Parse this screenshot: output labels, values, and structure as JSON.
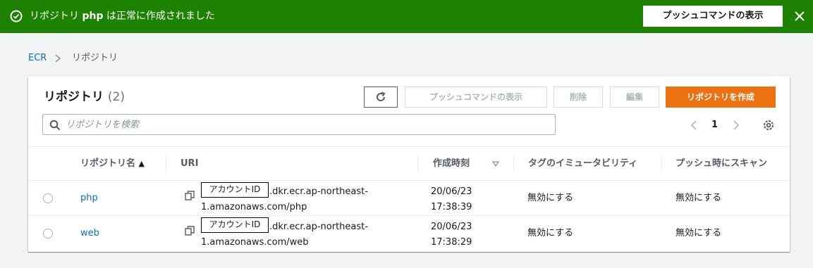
{
  "flash": {
    "message_prefix": "リポジトリ ",
    "repo_name": "php",
    "message_suffix": " は正常に作成されました",
    "push_commands_label": "プッシュコマンドの表示",
    "color": "#1d8102"
  },
  "breadcrumb": {
    "root": "ECR",
    "current": "リポジトリ"
  },
  "panel": {
    "title": "リポジトリ",
    "count": "(2)",
    "push_commands_label": "プッシュコマンドの表示",
    "delete_label": "削除",
    "edit_label": "編集",
    "create_label": "リポジトリを作成",
    "accent_color": "#ec7211",
    "refresh_icon": "refresh-icon"
  },
  "search": {
    "placeholder": "リポジトリを検索",
    "value": ""
  },
  "pagination": {
    "current_page": "1"
  },
  "table": {
    "columns": {
      "name": "リポジトリ名",
      "name_sort": "▲",
      "uri": "URI",
      "created": "作成時刻",
      "tag_immutability": "タグのイミュータビリティ",
      "scan_on_push": "プッシュ時にスキャン"
    },
    "rows": [
      {
        "name": "php",
        "account_id_label": "アカウントID",
        "uri_line1": ".dkr.ecr.ap-northeast-",
        "uri_line2": "1.amazonaws.com/php",
        "created_date": "20/06/23",
        "created_time": "17:38:39",
        "tag_immutability": "無効にする",
        "scan_on_push": "無効にする"
      },
      {
        "name": "web",
        "account_id_label": "アカウントID",
        "uri_line1": ".dkr.ecr.ap-northeast-",
        "uri_line2": "1.amazonaws.com/web",
        "created_date": "20/06/23",
        "created_time": "17:38:29",
        "tag_immutability": "無効にする",
        "scan_on_push": "無効にする"
      }
    ]
  }
}
